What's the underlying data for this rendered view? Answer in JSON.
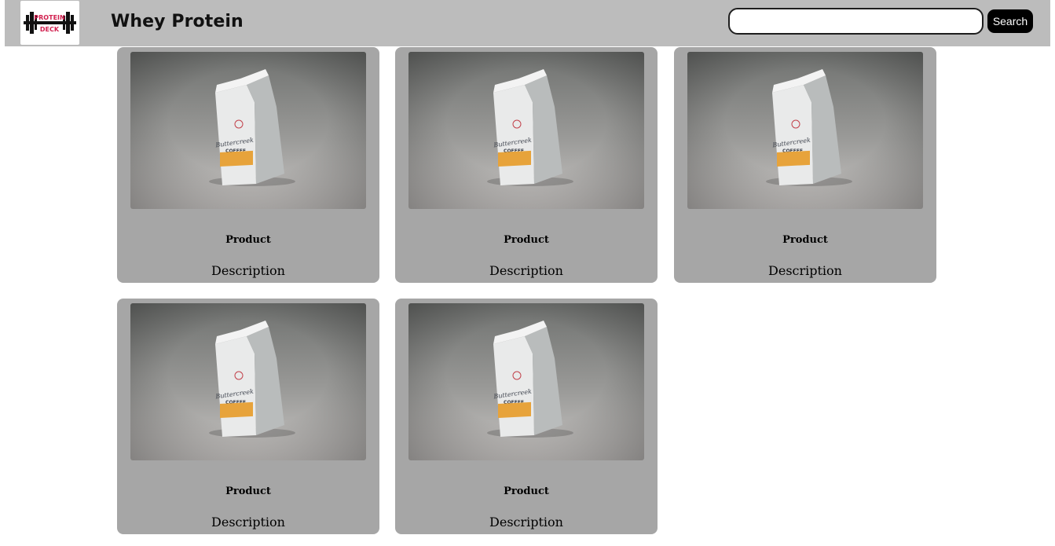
{
  "header": {
    "logo_text_top": "PROTEIN",
    "logo_text_bottom": "DECK",
    "title": "Whey Protein",
    "search": {
      "placeholder": "",
      "value": ""
    },
    "search_button_label": "Search"
  },
  "products": [
    {
      "name": "Product",
      "description": "Description",
      "bag_brand": "Buttercreek",
      "bag_label": "COFFEE"
    },
    {
      "name": "Product",
      "description": "Description",
      "bag_brand": "Buttercreek",
      "bag_label": "COFFEE"
    },
    {
      "name": "Product",
      "description": "Description",
      "bag_brand": "Buttercreek",
      "bag_label": "COFFEE"
    },
    {
      "name": "Product",
      "description": "Description",
      "bag_brand": "Buttercreek",
      "bag_label": "COFFEE"
    },
    {
      "name": "Product",
      "description": "Description",
      "bag_brand": "Buttercreek",
      "bag_label": "COFFEE"
    }
  ],
  "colors": {
    "navbar_bg": "#bcbcbc",
    "card_bg": "#a6a6a6",
    "button_bg": "#000000",
    "logo_accent": "#d11f4e"
  },
  "icons": {
    "logo": "barbell-logo-icon"
  }
}
